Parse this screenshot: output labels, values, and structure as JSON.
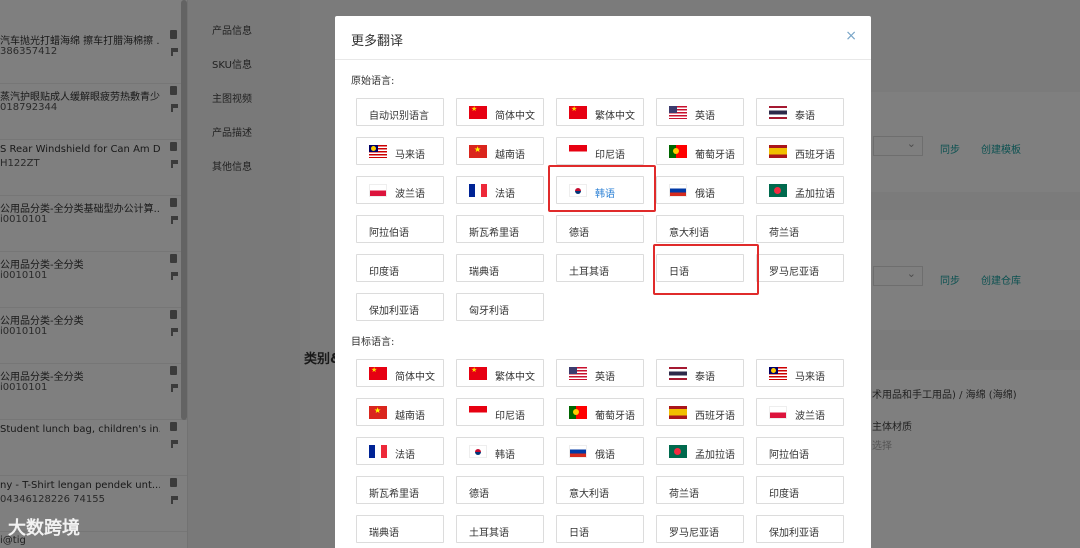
{
  "left_list": [
    {
      "title": "汽车抛光打蜡海绵 擦车打腊海棉擦 ...",
      "code": "386357412"
    },
    {
      "title": "蒸汽护眼贴成人缓解眼疲劳热敷青少 ...",
      "code": "018792344"
    },
    {
      "title": "S Rear Windshield for Can Am D...",
      "code": "H122ZT"
    },
    {
      "title": "公用品分类-全分类基础型办公计算...",
      "code": "i0010101"
    },
    {
      "title": "公用品分类-全分类",
      "code": "i0010101"
    },
    {
      "title": "公用品分类-全分类",
      "code": "i0010101"
    },
    {
      "title": "公用品分类-全分类",
      "code": "i0010101"
    },
    {
      "title": "Student lunch bag, children's in...",
      "code": ""
    },
    {
      "title": "ny - T-Shirt lengan pendek unt...",
      "code": "04346128226 74155"
    }
  ],
  "left_list_last": "i@tig",
  "nav": [
    "产品信息",
    "SKU信息",
    "主图视频",
    "产品描述",
    "其他信息"
  ],
  "background": {
    "sync1": "同步",
    "create_template": "创建模板",
    "sync2": "同步",
    "create_warehouse": "创建仓库",
    "category_label": "类别&",
    "category_path": "术用品和手工用品) / 海绵 (海绵)",
    "material": "主体材质",
    "select": "选择"
  },
  "modal": {
    "title": "更多翻译",
    "close_glyph": "×",
    "source_label": "原始语言:",
    "target_label": "目标语言:",
    "source_languages": [
      {
        "label": "自动识别语言",
        "flag": ""
      },
      {
        "label": "简体中文",
        "flag": "cn"
      },
      {
        "label": "繁体中文",
        "flag": "cn"
      },
      {
        "label": "英语",
        "flag": "us"
      },
      {
        "label": "泰语",
        "flag": "th"
      },
      {
        "label": "马来语",
        "flag": "my"
      },
      {
        "label": "越南语",
        "flag": "vn"
      },
      {
        "label": "印尼语",
        "flag": "id"
      },
      {
        "label": "葡萄牙语",
        "flag": "pt"
      },
      {
        "label": "西班牙语",
        "flag": "es"
      },
      {
        "label": "波兰语",
        "flag": "pl"
      },
      {
        "label": "法语",
        "flag": "fr"
      },
      {
        "label": "韩语",
        "flag": "kr"
      },
      {
        "label": "俄语",
        "flag": "ru"
      },
      {
        "label": "孟加拉语",
        "flag": "bd"
      },
      {
        "label": "阿拉伯语",
        "flag": ""
      },
      {
        "label": "斯瓦希里语",
        "flag": ""
      },
      {
        "label": "德语",
        "flag": ""
      },
      {
        "label": "意大利语",
        "flag": ""
      },
      {
        "label": "荷兰语",
        "flag": ""
      },
      {
        "label": "印度语",
        "flag": ""
      },
      {
        "label": "瑞典语",
        "flag": ""
      },
      {
        "label": "土耳其语",
        "flag": ""
      },
      {
        "label": "日语",
        "flag": ""
      },
      {
        "label": "罗马尼亚语",
        "flag": ""
      },
      {
        "label": "保加利亚语",
        "flag": ""
      },
      {
        "label": "匈牙利语",
        "flag": ""
      }
    ],
    "target_languages": [
      {
        "label": "简体中文",
        "flag": "cn"
      },
      {
        "label": "繁体中文",
        "flag": "cn"
      },
      {
        "label": "英语",
        "flag": "us"
      },
      {
        "label": "泰语",
        "flag": "th"
      },
      {
        "label": "马来语",
        "flag": "my"
      },
      {
        "label": "越南语",
        "flag": "vn"
      },
      {
        "label": "印尼语",
        "flag": "id"
      },
      {
        "label": "葡萄牙语",
        "flag": "pt"
      },
      {
        "label": "西班牙语",
        "flag": "es"
      },
      {
        "label": "波兰语",
        "flag": "pl"
      },
      {
        "label": "法语",
        "flag": "fr"
      },
      {
        "label": "韩语",
        "flag": "kr"
      },
      {
        "label": "俄语",
        "flag": "ru"
      },
      {
        "label": "孟加拉语",
        "flag": "bd"
      },
      {
        "label": "阿拉伯语",
        "flag": ""
      },
      {
        "label": "斯瓦希里语",
        "flag": ""
      },
      {
        "label": "德语",
        "flag": ""
      },
      {
        "label": "意大利语",
        "flag": ""
      },
      {
        "label": "荷兰语",
        "flag": ""
      },
      {
        "label": "印度语",
        "flag": ""
      },
      {
        "label": "瑞典语",
        "flag": ""
      },
      {
        "label": "土耳其语",
        "flag": ""
      },
      {
        "label": "日语",
        "flag": ""
      },
      {
        "label": "罗马尼亚语",
        "flag": ""
      },
      {
        "label": "保加利亚语",
        "flag": ""
      }
    ],
    "active_source": "韩语"
  },
  "watermark": "大数跨境",
  "colors": {
    "highlight": "#e02b2b",
    "link": "#1aa3a3",
    "active_text": "#2a7fd4"
  }
}
